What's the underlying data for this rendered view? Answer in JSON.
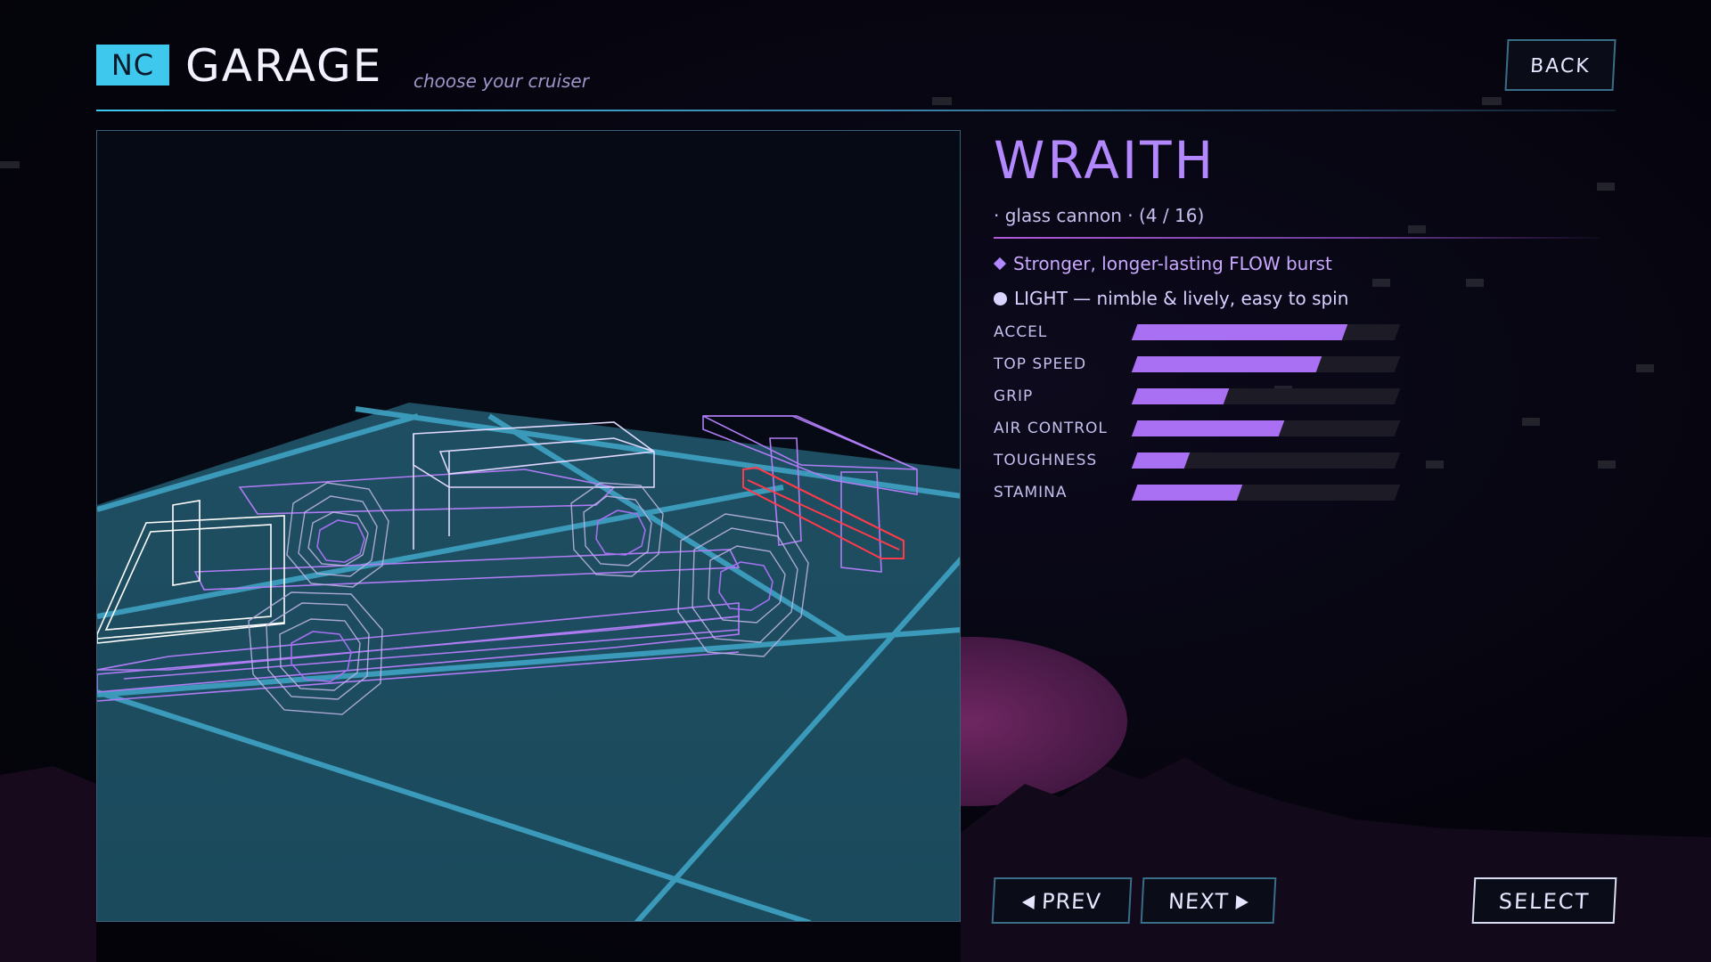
{
  "header": {
    "badge": "NC",
    "title": "GARAGE",
    "subtitle": "choose your cruiser",
    "back_label": "BACK"
  },
  "car": {
    "name": "WRAITH",
    "class_line": "· glass cannon ·  (4 / 16)",
    "features": [
      {
        "icon": "diamond-icon",
        "text": "Stronger, longer-lasting FLOW burst"
      },
      {
        "icon": "dot-icon",
        "text": "LIGHT — nimble & lively, easy to spin"
      }
    ],
    "stats": [
      {
        "label": "ACCEL",
        "value": 0.8
      },
      {
        "label": "TOP SPEED",
        "value": 0.7
      },
      {
        "label": "GRIP",
        "value": 0.35
      },
      {
        "label": "AIR CONTROL",
        "value": 0.56
      },
      {
        "label": "TOUGHNESS",
        "value": 0.2
      },
      {
        "label": "STAMINA",
        "value": 0.4
      }
    ]
  },
  "nav": {
    "prev_label": "PREV",
    "next_label": "NEXT",
    "select_label": "SELECT"
  },
  "colors": {
    "accent_cyan": "#3ec8ee",
    "accent_purple": "#a970f4",
    "wire_purple": "#b07cf5",
    "wire_white": "#e8e8ff",
    "wire_red": "#ff3b4b",
    "grid_cyan": "#3fa3c4"
  }
}
